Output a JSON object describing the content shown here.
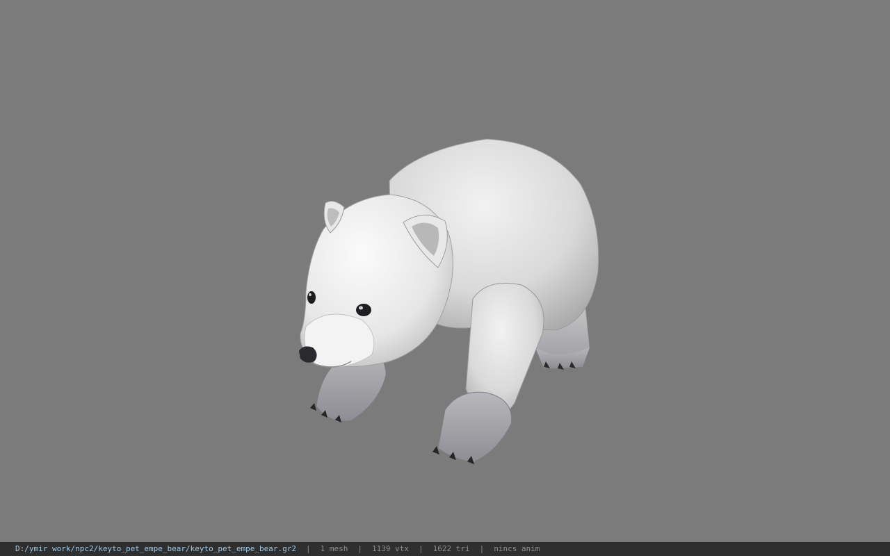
{
  "status": {
    "file_path": "D:/ymir work/npc2/keyto_pet_empe_bear/keyto_pet_empe_bear.gr2",
    "separator": "|",
    "mesh_count": "1 mesh",
    "vertex_count": "1139 vtx",
    "triangle_count": "1622 tri",
    "animation": "nincs anim"
  },
  "colors": {
    "viewport_background": "#7b7b7b",
    "statusbar_background": "#2f2f2f",
    "path_text": "#9fc9e6",
    "stat_text": "#8f8f8f"
  },
  "viewport": {
    "model_icon": "polar-bear-cub-model"
  }
}
